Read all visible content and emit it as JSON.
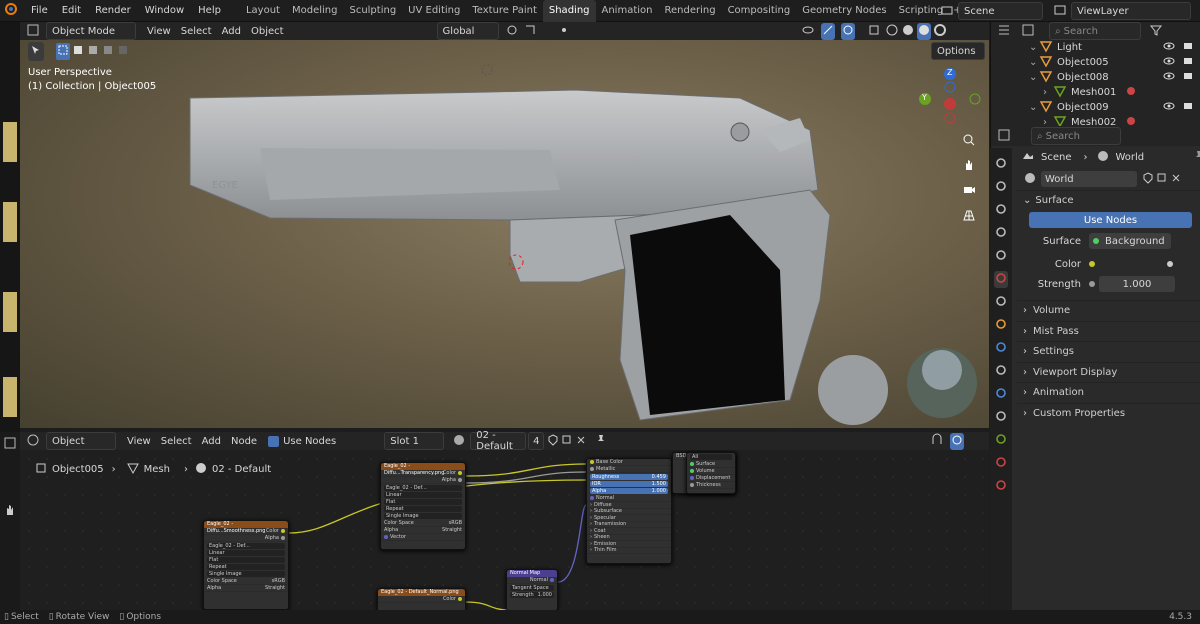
{
  "menu": [
    "File",
    "Edit",
    "Render",
    "Window",
    "Help"
  ],
  "workspaces": [
    "Layout",
    "Modeling",
    "Sculpting",
    "UV Editing",
    "Texture Paint",
    "Shading",
    "Animation",
    "Rendering",
    "Compositing",
    "Geometry Nodes",
    "Scripting"
  ],
  "active_workspace": "Shading",
  "add_tab": "+",
  "scene_name": "Scene",
  "view_layer": "ViewLayer",
  "viewport": {
    "mode": "Object Mode",
    "menus": [
      "View",
      "Select",
      "Add",
      "Object"
    ],
    "orientation": "Global",
    "options": "Options",
    "info_line1": "User Perspective",
    "info_line2": "(1) Collection | Object005",
    "slide_text_1": "EGYE",
    "gizmo": {
      "z": "Z",
      "y": "Y"
    }
  },
  "node_editor": {
    "type": "Object",
    "menus": [
      "View",
      "Select",
      "Add",
      "Node"
    ],
    "use_nodes": "Use Nodes",
    "slot": "Slot 1",
    "material": "02 - Default",
    "users": "4",
    "breadcrumb": [
      "Object005",
      "Mesh",
      "02 - Default"
    ],
    "nodes": {
      "tex1": {
        "title": "Eagle_02 - Diffu...Transparency.png",
        "color": "Color",
        "alpha": "Alpha",
        "img": "Eagle_02 - Def...",
        "interp": "Linear",
        "proj": "Flat",
        "ext": "Repeat",
        "src": "Single Image",
        "cs_label": "Color Space",
        "cs": "sRGB",
        "alpha_label": "Alpha",
        "alpha_val": "Straight",
        "vector": "Vector"
      },
      "tex2": {
        "title": "Eagle_02 - Diffu...Smoothness.png",
        "color": "Color",
        "alpha": "Alpha",
        "img": "Eagle_02 - Def...",
        "interp": "Linear",
        "proj": "Flat",
        "ext": "Repeat",
        "src": "Single Image",
        "cs_label": "Color Space",
        "cs": "sRGB",
        "alpha_label": "Alpha",
        "alpha_val": "Straight"
      },
      "tex3": {
        "title": "Eagle_02 - Default_Normal.png",
        "color": "Color"
      },
      "bsdf": {
        "base": "Base Color",
        "metallic": "Metallic",
        "roughness": "Roughness",
        "roughness_val": "0.459",
        "ior": "IOR",
        "ior_val": "1.500",
        "alpha": "Alpha",
        "alpha_val": "1.000",
        "normal": "Normal",
        "subs": [
          "Diffuse",
          "Subsurface",
          "Specular",
          "Transmission",
          "Coat",
          "Sheen",
          "Emission",
          "Thin Film"
        ]
      },
      "output": {
        "label": "BSDF",
        "sel": "All",
        "surface": "Surface",
        "volume": "Volume",
        "disp": "Displacement",
        "thick": "Thickness"
      },
      "normalmap": {
        "title": "Normal Map",
        "normal": "Normal",
        "space": "Tangent Space",
        "strength": "Strength",
        "strength_val": "1.000"
      }
    }
  },
  "outliner": {
    "search": "Search",
    "items": [
      {
        "label": "Light",
        "depth": 0
      },
      {
        "label": "Object005",
        "depth": 0
      },
      {
        "label": "Object008",
        "depth": 0
      },
      {
        "label": "Mesh001",
        "depth": 1
      },
      {
        "label": "Object009",
        "depth": 0
      },
      {
        "label": "Mesh002",
        "depth": 1
      }
    ]
  },
  "properties": {
    "search": "Search",
    "breadcrumb": [
      "Scene",
      "World"
    ],
    "world_name": "World",
    "panels": {
      "surface": "Surface",
      "use_nodes": "Use Nodes",
      "surface_label": "Surface",
      "surface_value": "Background",
      "color_label": "Color",
      "strength_label": "Strength",
      "strength_value": "1.000"
    },
    "collapsed": [
      "Volume",
      "Mist Pass",
      "Settings",
      "Viewport Display",
      "Animation",
      "Custom Properties"
    ]
  },
  "status": {
    "select": "Select",
    "rotate": "Rotate View",
    "options": "Options",
    "version": "4.5.3"
  },
  "colors": {
    "accent": "#4772b3",
    "tab_active": "#333333"
  }
}
